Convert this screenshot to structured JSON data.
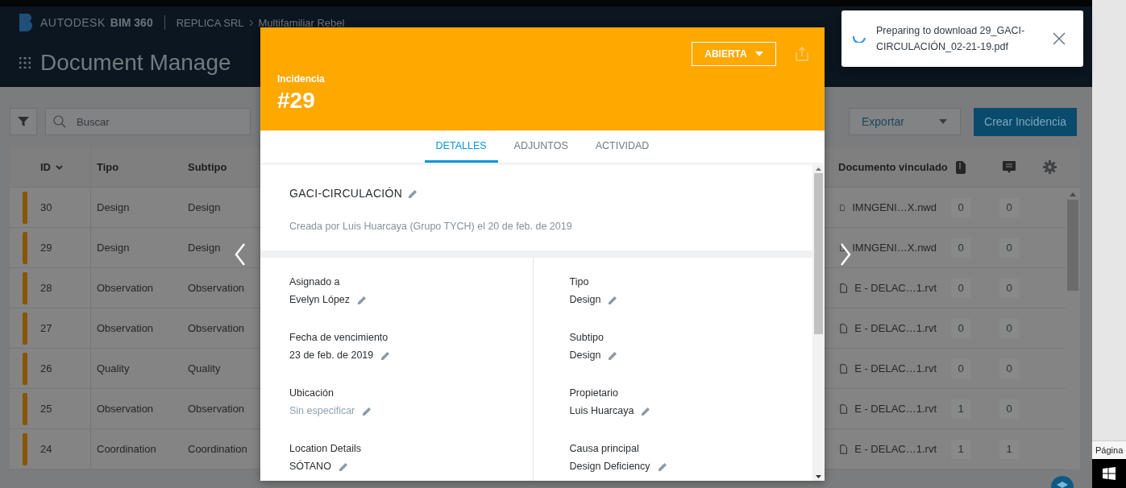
{
  "header": {
    "brand": "AUTODESK",
    "product": "BIM 360",
    "account": "REPLICA SRL",
    "project": "Multifamiliar Rebel",
    "page_title": "Document Manage"
  },
  "toolbar": {
    "search": {
      "placeholder": "Buscar"
    },
    "export": "Exportar",
    "create": "Crear Incidencia"
  },
  "table": {
    "columns": [
      {
        "label": "ID",
        "sorted": true
      },
      {
        "label": "Tipo",
        "sorted": false
      },
      {
        "label": "Subtipo",
        "sorted": false
      },
      {
        "label": "Documento vinculado",
        "sorted": false
      }
    ],
    "rows": [
      {
        "id": "30",
        "type": "Design",
        "subtype": "Design",
        "document": "IMNGENI…X.nwd",
        "attachments": "0",
        "comments": "0"
      },
      {
        "id": "29",
        "type": "Design",
        "subtype": "Design",
        "document": "IMNGENI…X.nwd",
        "attachments": "0",
        "comments": "0"
      },
      {
        "id": "28",
        "type": "Observation",
        "subtype": "Observation",
        "document": "E - DELAC…1.rvt",
        "attachments": "0",
        "comments": "0"
      },
      {
        "id": "27",
        "type": "Observation",
        "subtype": "Observation",
        "document": "E - DELAC…1.rvt",
        "attachments": "0",
        "comments": "0"
      },
      {
        "id": "26",
        "type": "Quality",
        "subtype": "Quality",
        "document": "E - DELAC…1.rvt",
        "attachments": "0",
        "comments": "0"
      },
      {
        "id": "25",
        "type": "Observation",
        "subtype": "Observation",
        "document": "E - DELAC…1.rvt",
        "attachments": "1",
        "comments": "0"
      },
      {
        "id": "24",
        "type": "Coordination",
        "subtype": "Coordination",
        "document": "E - DELAC…1.rvt",
        "attachments": "1",
        "comments": "1"
      }
    ]
  },
  "issue": {
    "label": "Incidencia",
    "number": "#29",
    "status": "ABIERTA",
    "tabs": [
      {
        "label": "DETALLES",
        "selected": true
      },
      {
        "label": "ADJUNTOS",
        "selected": false
      },
      {
        "label": "ACTIVIDAD",
        "selected": false
      }
    ],
    "title": "GACI-CIRCULACIÓN",
    "created": "Creada por Luis Huarcaya (Grupo TYCH) el 20 de feb. de 2019",
    "fields_left": [
      {
        "label": "Asignado a",
        "value": "Evelyn López",
        "empty": false
      },
      {
        "label": "Fecha de vencimiento",
        "value": "23 de feb. de 2019",
        "empty": false
      },
      {
        "label": "Ubicación",
        "value": "Sin especificar",
        "empty": true
      },
      {
        "label": "Location Details",
        "value": "SÓTANO",
        "empty": false
      }
    ],
    "fields_right": [
      {
        "label": "Tipo",
        "value": "Design",
        "empty": false
      },
      {
        "label": "Subtipo",
        "value": "Design",
        "empty": false
      },
      {
        "label": "Propietario",
        "value": "Luis Huarcaya",
        "empty": false
      },
      {
        "label": "Causa principal",
        "value": "Design Deficiency",
        "empty": false
      }
    ]
  },
  "toast": {
    "message": "Preparing to download 29_GACI-CIRCULACIÓN_02-21-19.pdf"
  },
  "side": {
    "label": "Página"
  }
}
